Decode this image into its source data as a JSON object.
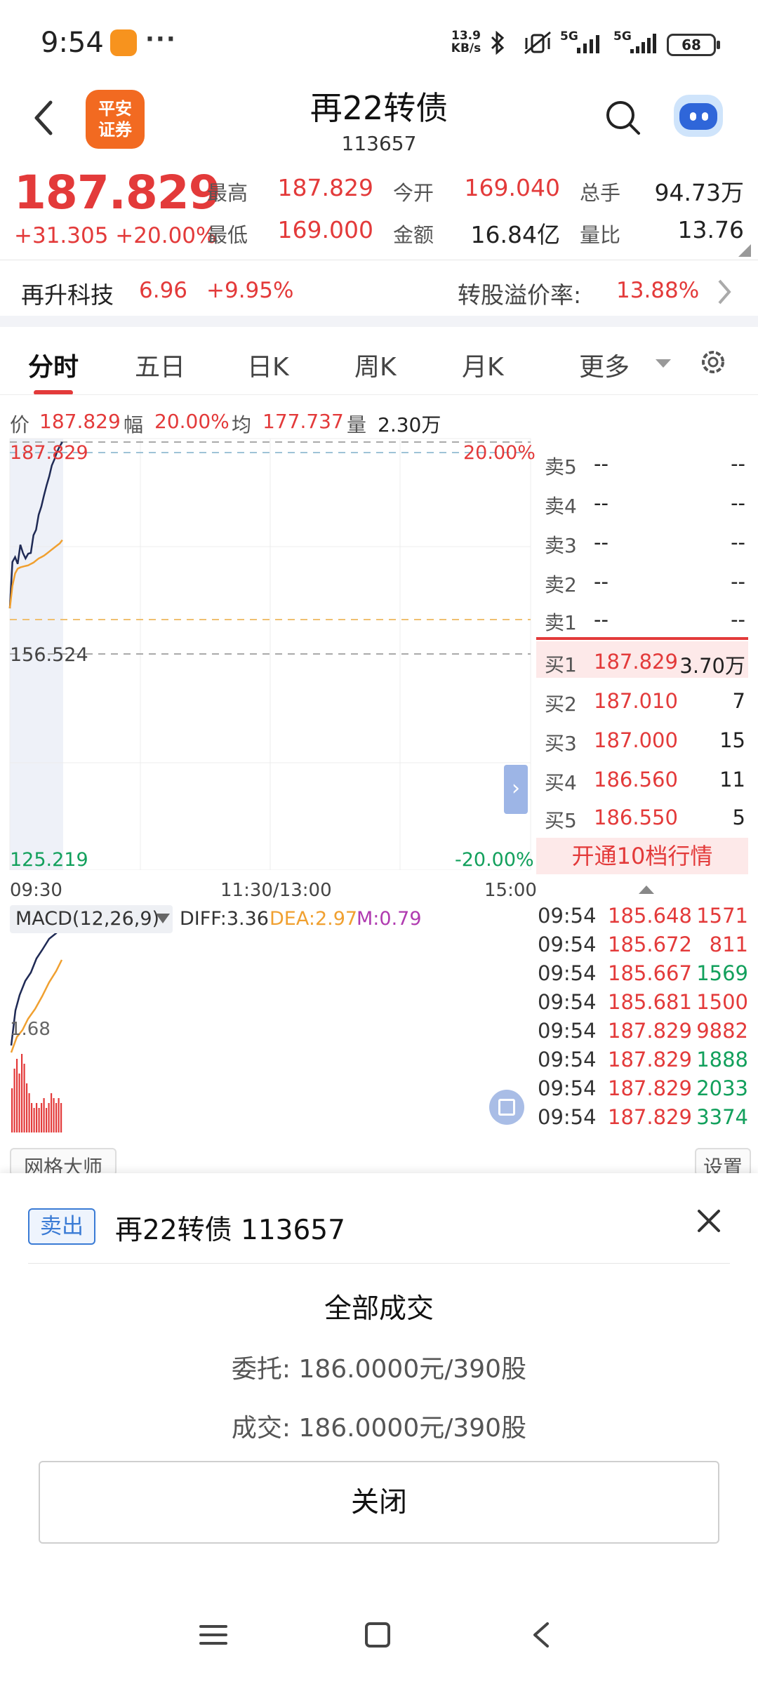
{
  "status": {
    "time": "9:54",
    "more": "···",
    "net_speed_value": "13.9",
    "net_speed_unit": "KB/s",
    "signal1": "5G",
    "signal2": "5G",
    "battery": "68"
  },
  "header": {
    "logo_line1": "平安",
    "logo_line2": "证券",
    "title": "再22转债",
    "code": "113657"
  },
  "quote": {
    "price": "187.829",
    "change": "+31.305 +20.00%",
    "high_label": "最高",
    "high_value": "187.829",
    "open_label": "今开",
    "open_value": "169.040",
    "total_hands_label": "总手",
    "total_hands_value": "94.73万",
    "low_label": "最低",
    "low_value": "169.000",
    "amount_label": "金额",
    "amount_value": "16.84亿",
    "vol_ratio_label": "量比",
    "vol_ratio_value": "13.76",
    "underlying_name": "再升科技",
    "underlying_price": "6.96",
    "underlying_change": "+9.95%",
    "premium_label": "转股溢价率:",
    "premium_value": "13.88%"
  },
  "tabs": [
    "分时",
    "五日",
    "日K",
    "周K",
    "月K",
    "更多"
  ],
  "info_line": {
    "price_label": "价",
    "price_value": "187.829",
    "range_label": "幅",
    "range_value": "20.00%",
    "avg_label": "均",
    "avg_value": "177.737",
    "vol_label": "量",
    "vol_value": "2.30万"
  },
  "chart": {
    "y_top": "187.829",
    "y_mid": "156.524",
    "y_bot": "125.219",
    "pct_top": "20.00%",
    "pct_bot": "-20.00%",
    "x_start": "09:30",
    "x_mid": "11:30/13:00",
    "x_end": "15:00",
    "expand": "›"
  },
  "chart_data": {
    "type": "line",
    "xlabel": "",
    "ylabel": "",
    "ylim": [
      125.219,
      187.829
    ],
    "series": [
      {
        "values": [
          163.5,
          170.3,
          171.0,
          170.0,
          172.8,
          171.6,
          170.8,
          171.5,
          171.6,
          174.2,
          175.0,
          177.2,
          178.4,
          180.0,
          181.5,
          182.8,
          184.4,
          185.3,
          186.4,
          187.2,
          187.829
        ]
      },
      {
        "values": [
          163.5,
          166.8,
          168.6,
          169.3,
          169.5,
          169.6,
          169.7,
          169.8,
          170.0,
          170.2,
          170.5,
          170.8,
          171.0,
          171.2,
          171.5,
          171.8,
          172.1,
          172.4,
          172.7,
          173.0,
          173.5
        ]
      }
    ],
    "grid": true,
    "legend": "none"
  },
  "orderbook": {
    "sells": [
      {
        "label": "卖5",
        "price": "--",
        "vol": "--"
      },
      {
        "label": "卖4",
        "price": "--",
        "vol": "--"
      },
      {
        "label": "卖3",
        "price": "--",
        "vol": "--"
      },
      {
        "label": "卖2",
        "price": "--",
        "vol": "--"
      },
      {
        "label": "卖1",
        "price": "--",
        "vol": "--"
      }
    ],
    "buys": [
      {
        "label": "买1",
        "price": "187.829",
        "vol": "3.70万"
      },
      {
        "label": "买2",
        "price": "187.010",
        "vol": "7"
      },
      {
        "label": "买3",
        "price": "187.000",
        "vol": "15"
      },
      {
        "label": "买4",
        "price": "186.560",
        "vol": "11"
      },
      {
        "label": "买5",
        "price": "186.550",
        "vol": "5"
      }
    ],
    "open_level10": "开通10档行情"
  },
  "ticks": [
    {
      "time": "09:54",
      "price": "185.648",
      "vol": "1571",
      "color": "#e33a3a"
    },
    {
      "time": "09:54",
      "price": "185.672",
      "vol": "811",
      "color": "#e33a3a"
    },
    {
      "time": "09:54",
      "price": "185.667",
      "vol": "1569",
      "color": "#12a05c"
    },
    {
      "time": "09:54",
      "price": "185.681",
      "vol": "1500",
      "color": "#e33a3a"
    },
    {
      "time": "09:54",
      "price": "187.829",
      "vol": "9882",
      "color": "#e33a3a"
    },
    {
      "time": "09:54",
      "price": "187.829",
      "vol": "1888",
      "color": "#12a05c"
    },
    {
      "time": "09:54",
      "price": "187.829",
      "vol": "2033",
      "color": "#12a05c"
    },
    {
      "time": "09:54",
      "price": "187.829",
      "vol": "3374",
      "color": "#12a05c"
    }
  ],
  "macd": {
    "name": "MACD(12,26,9)",
    "diff": "DIFF:3.36",
    "dea": "DEA:2.97",
    "m": "M:0.79",
    "y_label": "1.68",
    "bars": [
      0.9,
      1.3,
      1.5,
      1.2,
      1.6,
      1.4,
      1.0,
      0.8,
      0.6,
      0.5,
      0.6,
      0.5,
      0.6,
      0.7,
      0.5,
      0.6,
      0.8,
      0.7,
      0.6,
      0.7,
      0.6
    ]
  },
  "bottom_buttons": {
    "left": "网格大师",
    "right": "设置"
  },
  "sheet": {
    "badge": "卖出",
    "title": "再22转债 113657",
    "status": "全部成交",
    "order_line": "委托:  186.0000元/390股",
    "deal_line": "成交:  186.0000元/390股",
    "close_button": "关闭"
  },
  "colors": {
    "up": "#e33a3a",
    "down": "#12a05c",
    "accent": "#3a7bd5",
    "price_line": "#1f2a55",
    "avg_line": "#f0a030"
  },
  "icons": {
    "back": "back-arrow-icon",
    "search": "search-icon",
    "assistant": "robot-icon",
    "settings": "gear-icon",
    "close": "close-icon"
  }
}
